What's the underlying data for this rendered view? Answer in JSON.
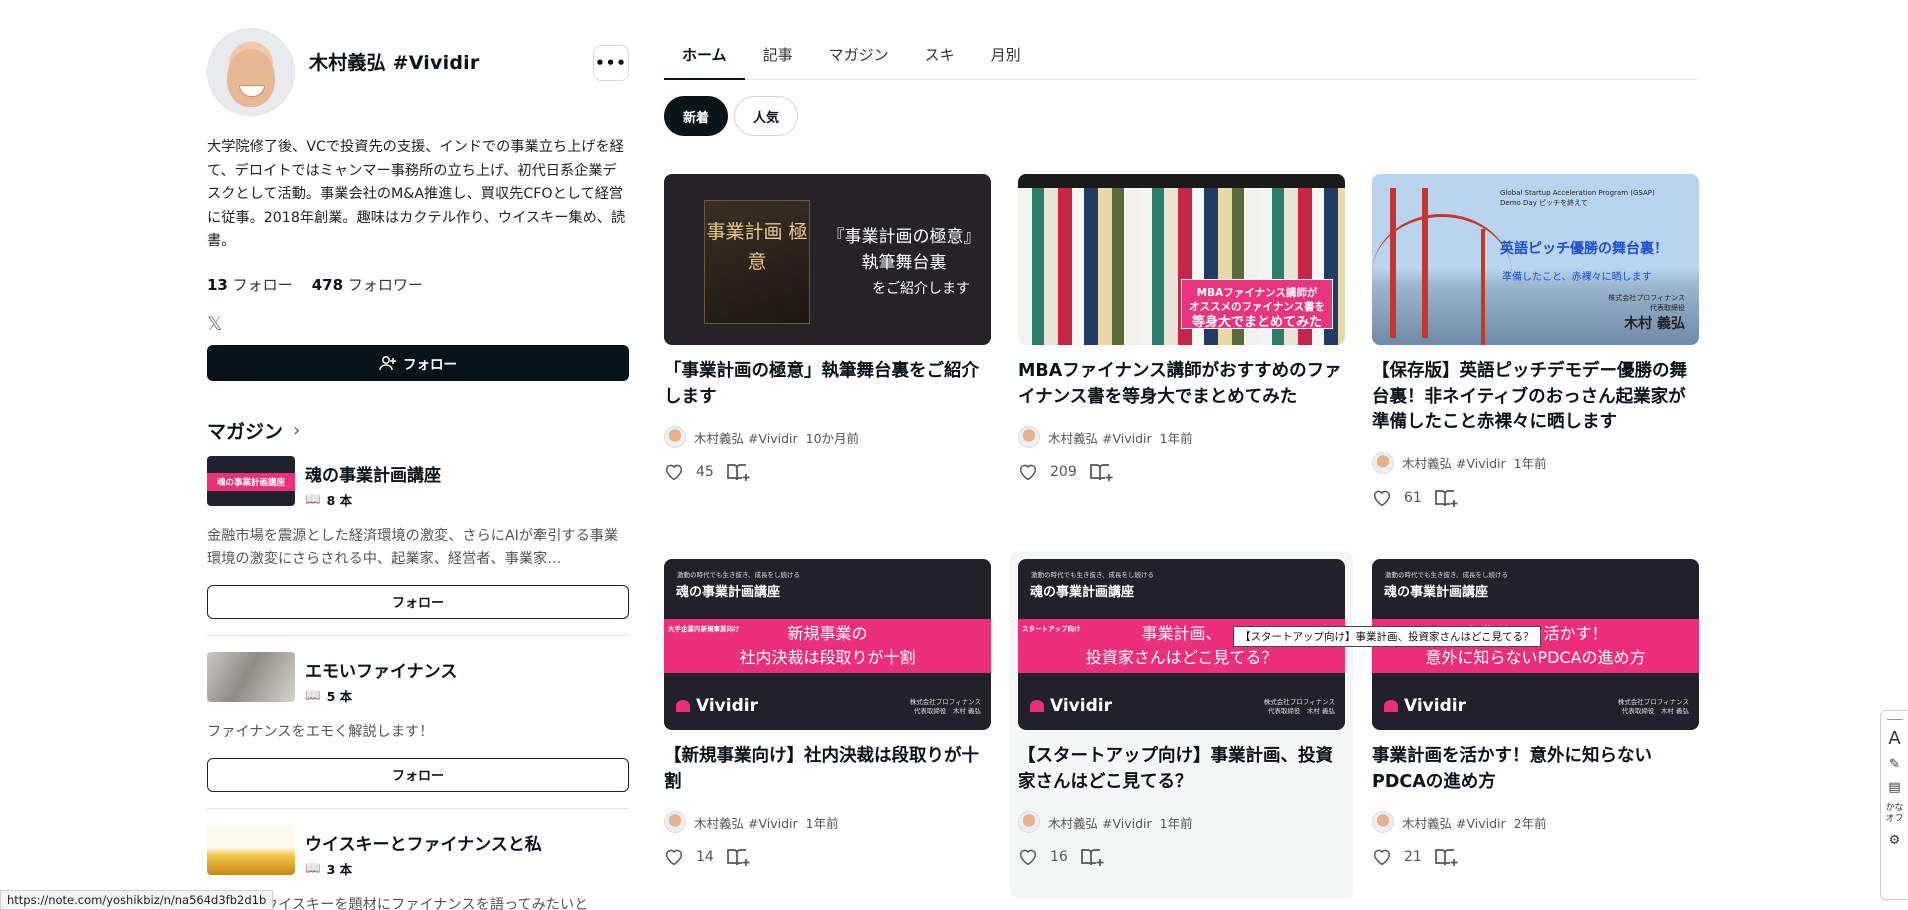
{
  "profile": {
    "name": "木村義弘 #Vividir",
    "more_label": "•••",
    "bio": "大学院修了後、VCで投資先の支援、インドでの事業立ち上げを経て、デロイトではミャンマー事務所の立ち上げ、初代日系企業デスクとして活動。事業会社のM&A推進し、買収先CFOとして経営に従事。2018年創業。趣味はカクテル作り、ウイスキー集め、読書。",
    "follow_count": "13",
    "follow_label": "フォロー",
    "follower_count": "478",
    "follower_label": "フォロワー",
    "x_icon": "𝕏",
    "follow_button": "フォロー"
  },
  "magazines": {
    "heading": "マガジン",
    "items": [
      {
        "title": "魂の事業計画講座",
        "count": "8 本",
        "thumb_text": "魂の事業計画講座",
        "desc": "金融市場を震源とした経済環境の激変、さらにAIが牽引する事業環境の激変にさらされる中、起業家、経営者、事業家…",
        "follow": "フォロー"
      },
      {
        "title": "エモいファイナンス",
        "count": "5 本",
        "desc": "ファイナンスをエモく解説します！",
        "follow": "フォロー"
      },
      {
        "title": "ウイスキーとファイナンスと私",
        "count": "3 本",
        "desc": "日本初？ウイスキーを題材にファイナンスを語ってみたいと"
      }
    ]
  },
  "tabs": [
    "ホーム",
    "記事",
    "マガジン",
    "スキ",
    "月別"
  ],
  "chips": [
    "新着",
    "人気"
  ],
  "cards": [
    {
      "title": "「事業計画の極意」執筆舞台裏をご紹介します",
      "author": "木村義弘 #Vividir",
      "time": "10か月前",
      "likes": "45",
      "thumb": {
        "book": "事業計画 極意",
        "line1": "『事業計画の極意』",
        "line2": "執筆舞台裏",
        "line3": "をご紹介します"
      }
    },
    {
      "title": "MBAファイナンス講師がおすすめのファイナンス書を等身大でまとめてみた",
      "author": "木村義弘 #Vividir",
      "time": "1年前",
      "likes": "209",
      "thumb": {
        "line1": "MBAファイナンス講師が",
        "line2": "オススメのファイナンス書を",
        "line3": "等身大でまとめてみた"
      }
    },
    {
      "title": "【保存版】英語ピッチデモデー優勝の舞台裏！非ネイティブのおっさん起業家が準備したこと赤裸々に晒します",
      "author": "木村義弘 #Vividir",
      "time": "1年前",
      "likes": "61",
      "thumb": {
        "program": "Global Startup Acceleration Program (GSAP)",
        "program2": "Demo Day ピッチを終えて",
        "title": "英語ピッチ優勝の舞台裏！",
        "sub": "準備したこと、赤裸々に晒します",
        "company": "株式会社プロフィナンス",
        "role": "代表取締役",
        "name": "木村 義弘"
      }
    },
    {
      "title": "【新規事業向け】社内決裁は段取りが十割",
      "author": "木村義弘 #Vividir",
      "time": "1年前",
      "likes": "14",
      "thumb": {
        "small": "激動の時代でも生き抜き、成長をし続ける",
        "series": "魂の事業計画講座",
        "tag": "大手企業内新規事業向け",
        "line1": "新規事業の",
        "line2": "社内決裁は段取りが十割",
        "logo": "Vividir",
        "co1": "株式会社プロフィナンス",
        "co2": "代表取締役　木村 義弘"
      }
    },
    {
      "title": "【スタートアップ向け】事業計画、投資家さんはどこ見てる？",
      "author": "木村義弘 #Vividir",
      "time": "1年前",
      "likes": "16",
      "thumb": {
        "small": "激動の時代でも生き抜き、成長をし続ける",
        "series": "魂の事業計画講座",
        "tag": "スタートアップ向け",
        "line1": "事業計画、",
        "line2": "投資家さんはどこ見てる？",
        "logo": "Vividir",
        "co1": "株式会社プロフィナンス",
        "co2": "代表取締役　木村 義弘"
      }
    },
    {
      "title": "事業計画を活かす！意外に知らないPDCAの進め方",
      "author": "木村義弘 #Vividir",
      "time": "2年前",
      "likes": "21",
      "thumb": {
        "small": "激動の時代でも生き抜き、成長をし続ける",
        "series": "魂の事業計画講座",
        "line1": "事業計画を活かす！",
        "line2": "意外に知らないPDCAの進め方",
        "logo": "Vividir",
        "co1": "株式会社プロフィナンス",
        "co2": "代表取締役　木村 義弘"
      }
    }
  ],
  "tooltip": "【スタートアップ向け】事業計画、投資家さんはどこ見てる？",
  "status_url": "https://note.com/yoshikbiz/n/na564d3fb2d1b",
  "tools": {
    "kana": "かな オフ"
  }
}
